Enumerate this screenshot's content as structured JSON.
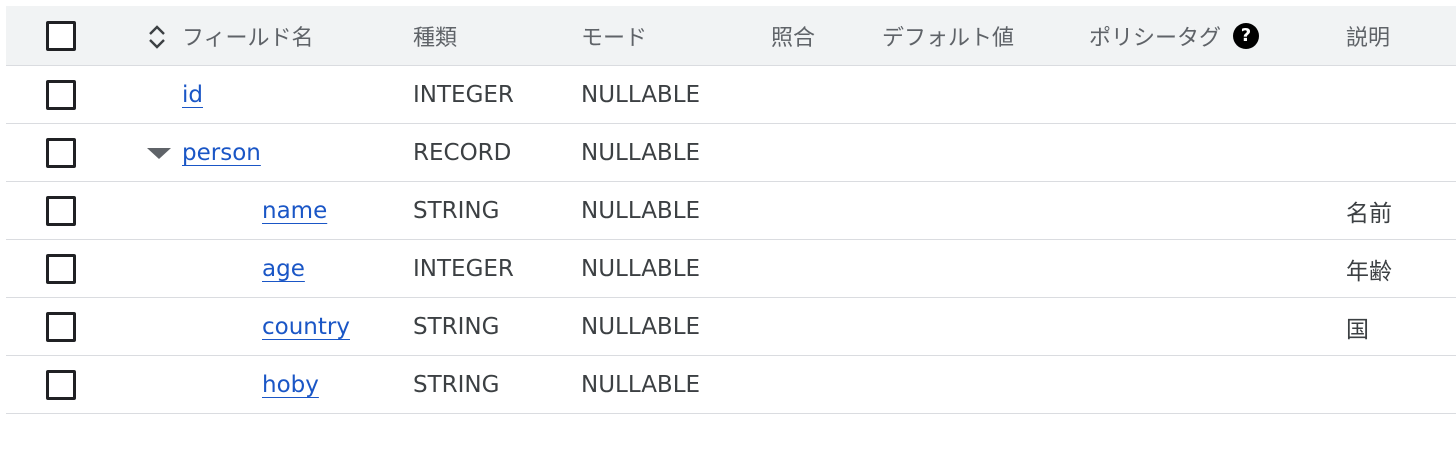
{
  "header": {
    "field_name": "フィールド名",
    "type": "種類",
    "mode": "モード",
    "collation": "照合",
    "default_value": "デフォルト値",
    "policy_tag": "ポリシータグ",
    "description": "説明",
    "help_icon": "?"
  },
  "rows": [
    {
      "name": "id",
      "type": "INTEGER",
      "mode": "NULLABLE",
      "description": ""
    },
    {
      "name": "person",
      "type": "RECORD",
      "mode": "NULLABLE",
      "description": ""
    },
    {
      "name": "name",
      "type": "STRING",
      "mode": "NULLABLE",
      "description": "名前"
    },
    {
      "name": "age",
      "type": "INTEGER",
      "mode": "NULLABLE",
      "description": "年齢"
    },
    {
      "name": "country",
      "type": "STRING",
      "mode": "NULLABLE",
      "description": "国"
    },
    {
      "name": "hoby",
      "type": "STRING",
      "mode": "NULLABLE",
      "description": ""
    }
  ],
  "icons": {
    "sort": "unfold-more-icon",
    "expand": "arrow-drop-down-icon",
    "help": "help-circle-icon"
  }
}
